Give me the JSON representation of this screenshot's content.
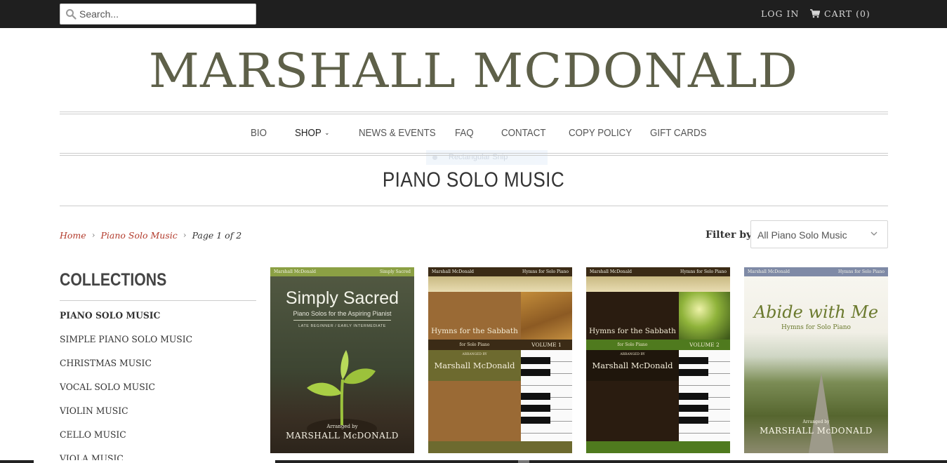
{
  "header": {
    "search_placeholder": "Search...",
    "login_label": "LOG IN",
    "cart_label": "CART (0)"
  },
  "logo": "MARSHALL MCDONALD",
  "nav": {
    "items": [
      {
        "label": "BIO"
      },
      {
        "label": "SHOP"
      },
      {
        "label": "NEWS & EVENTS"
      },
      {
        "label": "FAQ"
      },
      {
        "label": "CONTACT"
      },
      {
        "label": "COPY POLICY"
      },
      {
        "label": "GIFT CARDS"
      }
    ],
    "snip_overlay": "Rectangular Snip"
  },
  "page_title": "PIANO SOLO MUSIC",
  "breadcrumb": {
    "home": "Home",
    "collection": "Piano Solo Music",
    "page": "Page 1 of 2"
  },
  "filter": {
    "label": "Filter by:",
    "selected": "All Piano Solo Music"
  },
  "sidebar": {
    "title": "COLLECTIONS",
    "items": [
      {
        "label": "PIANO SOLO MUSIC",
        "active": true
      },
      {
        "label": "SIMPLE PIANO SOLO MUSIC"
      },
      {
        "label": "CHRISTMAS MUSIC"
      },
      {
        "label": "VOCAL SOLO MUSIC"
      },
      {
        "label": "VIOLIN MUSIC"
      },
      {
        "label": "CELLO MUSIC"
      },
      {
        "label": "VIOLA MUSIC"
      }
    ]
  },
  "products": [
    {
      "head_left": "Marshall McDonald",
      "head_right": "Simply Sacred",
      "title": "Simply Sacred",
      "subtitle": "Piano Solos for the Aspiring Pianist",
      "level": "LATE BEGINNER / EARLY INTERMEDIATE",
      "arranged": "Arranged by",
      "name": "MARSHALL McDONALD"
    },
    {
      "head_left": "Marshall McDonald",
      "head_right": "Hymns for Solo Piano",
      "title": "Hymns for the Sabbath",
      "subtitle": "for Solo Piano",
      "volume": "VOLUME 1",
      "arranged": "ARRANGED BY",
      "name": "Marshall McDonald"
    },
    {
      "head_left": "Marshall McDonald",
      "head_right": "Hymns for Solo Piano",
      "title": "Hymns for the Sabbath",
      "subtitle": "for Solo Piano",
      "volume": "VOLUME 2",
      "arranged": "ARRANGED BY",
      "name": "Marshall McDonald"
    },
    {
      "head_left": "Marshall McDonald",
      "head_right": "Hymns for Solo Piano",
      "title": "Abide with Me",
      "subtitle": "Hymns for Solo Piano",
      "arranged": "Arranged by",
      "name": "MARSHALL McDONALD"
    }
  ],
  "colors": {
    "logo": "#5e6049",
    "link_red": "#b23a2b",
    "topbar": "#1f1f1f"
  }
}
